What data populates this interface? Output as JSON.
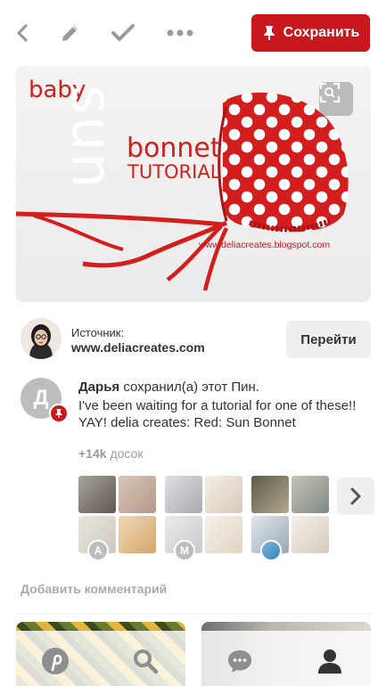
{
  "toolbar": {
    "back_icon": "chevron-left-icon",
    "edit_icon": "pencil-icon",
    "done_icon": "checkmark-icon",
    "more_icon": "more-dots-icon",
    "save_label": "Сохранить",
    "accent": "#c8171d"
  },
  "pin": {
    "image_text": {
      "baby": "baby",
      "sun": "sun",
      "bonnet": "bonnet",
      "tutorial": "TUTORIAL",
      "url": "www.deliacreates.blogspot.com"
    },
    "lens_icon": "visual-search-icon"
  },
  "source": {
    "label": "Источник:",
    "url": "www.deliacreates.com",
    "go_label": "Перейти"
  },
  "saver": {
    "initial": "Д",
    "name": "Дарья",
    "action": "сохранил(а) этот Пин.",
    "description": "I've been waiting for a tutorial for one of these!! YAY! delia creates: Red: Sun Bonnet",
    "boards_count": "+14k",
    "boards_label": "досок"
  },
  "boards": [
    {
      "owner_initial": "A"
    },
    {
      "owner_initial": "M"
    },
    {
      "owner_initial": ""
    }
  ],
  "comment": {
    "placeholder": "Добавить комментарий"
  },
  "nav": {
    "items": [
      "pinterest-logo-icon",
      "search-icon",
      "messages-icon",
      "profile-icon"
    ]
  }
}
